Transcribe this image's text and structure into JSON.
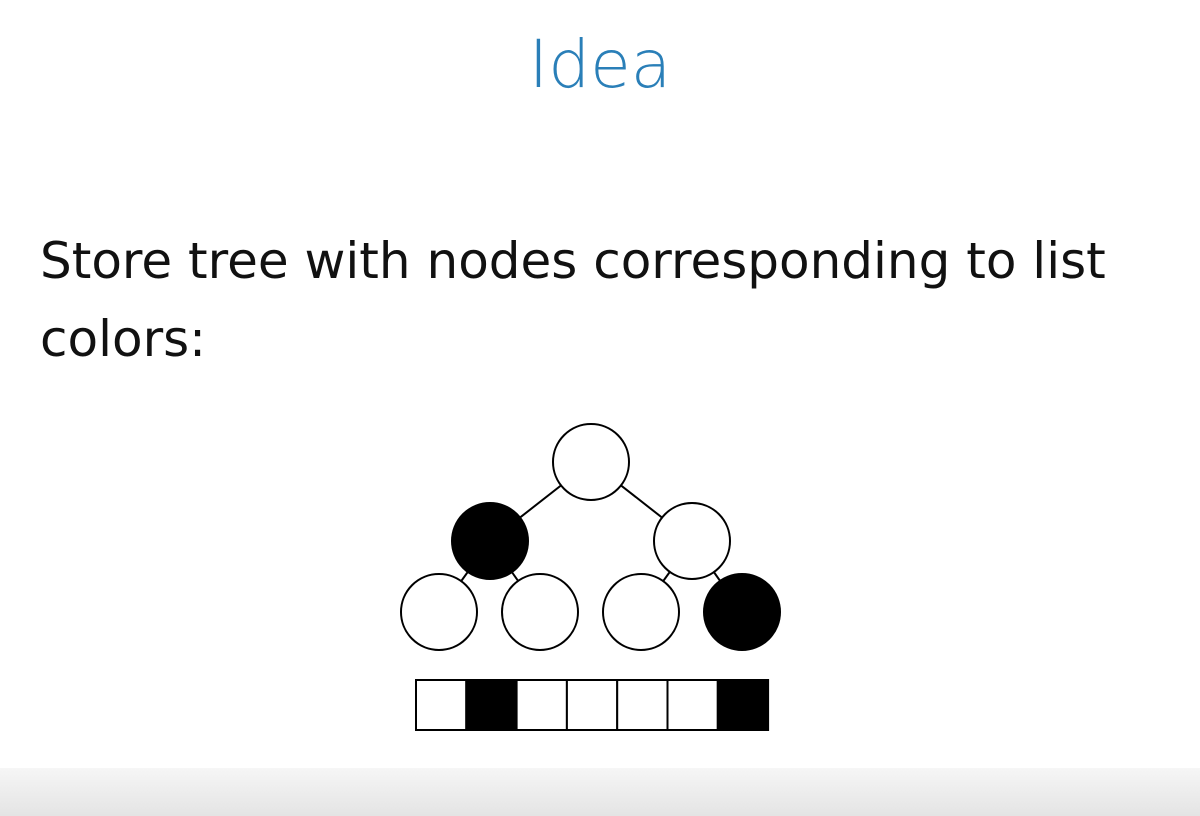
{
  "slide": {
    "title": "Idea",
    "body_line1": "Store tree with nodes corresponding to list",
    "body_line2": "colors:"
  },
  "colors": {
    "title": "#2a7fb8",
    "text": "#111111",
    "filled": "#000000",
    "empty": "#ffffff"
  },
  "tree": {
    "levels": [
      [
        "white"
      ],
      [
        "black",
        "white"
      ],
      [
        "white",
        "white",
        "white",
        "black"
      ]
    ]
  },
  "list": {
    "cells": [
      "white",
      "black",
      "white",
      "white",
      "white",
      "white",
      "black"
    ]
  }
}
